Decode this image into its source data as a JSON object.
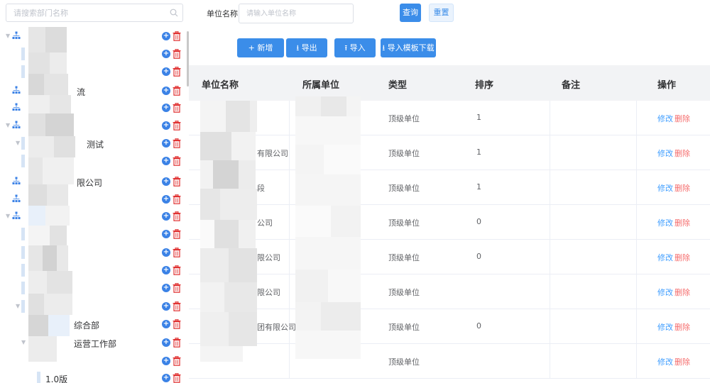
{
  "tree": {
    "search_placeholder": "请搜索部门名称",
    "visible_label_fragments": [
      "流",
      "测试",
      "限公司",
      "综合部",
      "运营工作部",
      "1.0版"
    ]
  },
  "filter": {
    "unit_name_label": "单位名称",
    "unit_name_placeholder": "请输入单位名称",
    "query_label": "查询",
    "reset_label": "重置"
  },
  "toolbar": {
    "add_label": "+ 新增",
    "export_label": "⭳ 导出",
    "import_label": "⭱ 导入",
    "template_label": "⭳ 导入模板下载"
  },
  "table": {
    "columns": [
      "单位名称",
      "所属单位",
      "类型",
      "排序",
      "备注",
      "操作"
    ],
    "rows": [
      {
        "name": "",
        "parent": "",
        "type": "顶级单位",
        "order": "1",
        "remark": ""
      },
      {
        "name": "有限公司",
        "parent": "",
        "type": "顶级单位",
        "order": "1",
        "remark": ""
      },
      {
        "name": "段",
        "parent": "",
        "type": "顶级单位",
        "order": "1",
        "remark": ""
      },
      {
        "name": "公司",
        "parent": "",
        "type": "顶级单位",
        "order": "0",
        "remark": ""
      },
      {
        "name": "限公司",
        "parent": "",
        "type": "顶级单位",
        "order": "0",
        "remark": ""
      },
      {
        "name": "限公司",
        "parent": "",
        "type": "顶级单位",
        "order": "",
        "remark": ""
      },
      {
        "name": "团有限公司",
        "parent": "",
        "type": "顶级单位",
        "order": "0",
        "remark": ""
      },
      {
        "name": "",
        "parent": "",
        "type": "顶级单位",
        "order": "",
        "remark": ""
      }
    ],
    "edit_label": "修改",
    "delete_label": "删除"
  },
  "colors": {
    "primary": "#3b8de9",
    "link": "#409eff",
    "danger": "#f56c6c",
    "add_icon": "#3b82e6",
    "delete_icon": "#e03030",
    "header_bg": "#f2f3f5"
  },
  "icons": [
    "search-icon",
    "org-tree-icon",
    "add-circle-icon",
    "trash-icon",
    "expand-arrow-icon"
  ]
}
